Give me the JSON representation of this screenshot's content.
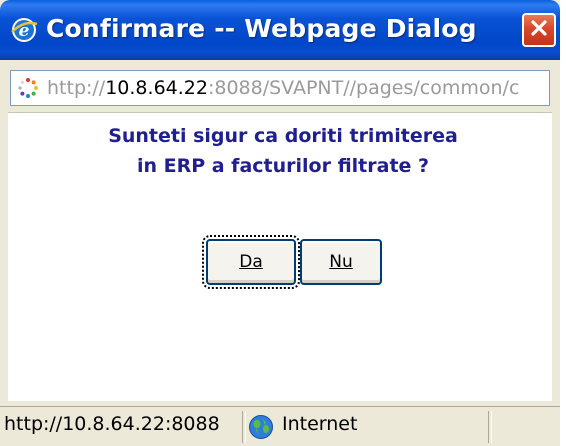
{
  "window": {
    "title": "Confirmare -- Webpage Dialog",
    "title_bar_color": "#0A4CD0",
    "close_button_color": "#D8472A"
  },
  "address_bar": {
    "url_prefix": "http://",
    "url_host": "10.8.64.22",
    "url_rest": ":8088/SVAPNT//pages/common/c"
  },
  "dialog": {
    "message": "Sunteti sigur ca doriti trimiterea in ERP a facturilor filtrate ?",
    "buttons": {
      "yes_label": "Da",
      "no_label": "Nu"
    },
    "message_color": "#1F1F8F"
  },
  "status_bar": {
    "url_text": "http://10.8.64.22:8088",
    "zone_label": "Internet"
  },
  "icons": {
    "title": "internet-explorer-icon",
    "close": "close-icon",
    "address": "loading-icon",
    "status": "globe-icon"
  }
}
